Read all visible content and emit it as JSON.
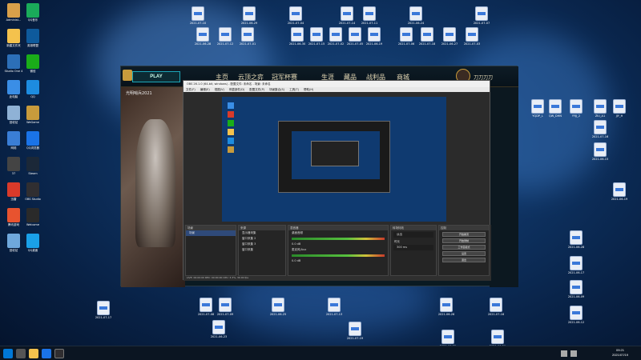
{
  "desktop": {
    "left_icons": [
      {
        "label": "Administ...",
        "color": "#d9a04a"
      },
      {
        "label": "新建文件夹",
        "color": "#f4c24d"
      },
      {
        "label": "Studio One 4",
        "color": "#2c6fb8"
      },
      {
        "label": "此电脑",
        "color": "#3a8ee6"
      },
      {
        "label": "回收站",
        "color": "#8fb2d6"
      },
      {
        "label": "网络",
        "color": "#3a7ed6"
      },
      {
        "label": "37",
        "color": "#444"
      },
      {
        "label": "迅雷",
        "color": "#d93a2a"
      },
      {
        "label": "腾讯游戏",
        "color": "#e8532f"
      },
      {
        "label": "回收站",
        "color": "#6fa8dc"
      },
      {
        "label": "QQ音乐",
        "color": "#1aab5a"
      },
      {
        "label": "英雄联盟",
        "color": "#0e5a9c"
      },
      {
        "label": "微信",
        "color": "#1aad19"
      },
      {
        "label": "QQ",
        "color": "#1d8ce0"
      },
      {
        "label": "WeGame",
        "color": "#c89b3c"
      },
      {
        "label": "QQ浏览器",
        "color": "#1a73e8"
      },
      {
        "label": "Steam",
        "color": "#1b2838"
      },
      {
        "label": "OBS Studio",
        "color": "#302e31"
      },
      {
        "label": "Welcome",
        "color": "#2a2a2a"
      },
      {
        "label": "QQ桌面",
        "color": "#1aa0e8"
      }
    ],
    "doc_labels": [
      "2021-06-28",
      "2021-07-12",
      "2021-07-01",
      "2021-06-30",
      "2021-07-15",
      "2021-07-02",
      "2021-07-05",
      "2021-06-19",
      "2021-07-06",
      "2021-07-18",
      "2021-06-27",
      "2021-07-03",
      "2021-07-10",
      "2021-06-29",
      "2021-07-04",
      "2021-07-14",
      "2021-07-11",
      "2021-06-24",
      "2021-07-07",
      "2021-07-08",
      "2021-07-09",
      "2021-06-25",
      "2021-07-13",
      "2021-06-26",
      "2021-07-16",
      "2021-07-17",
      "2021-06-22",
      "2021-06-21",
      "2021-06-23",
      "2021-07-19"
    ],
    "right_labels": [
      "YQDP_L",
      "QW_DHN",
      "YYJJ_2",
      "ZIU_A1",
      "JJY_H",
      "2021-06-28",
      "2021-06-17",
      "2021-06-09",
      "2021-06-12",
      "2021-07-16",
      "2021-06-15",
      "2021-06-19"
    ]
  },
  "lol": {
    "play_label": "PLAY",
    "tabs": [
      {
        "label": "主页",
        "key": "home"
      },
      {
        "label": "云顶之弈",
        "key": "tft"
      },
      {
        "label": "冠军杯赛",
        "key": "clash"
      },
      {
        "label": "生涯",
        "key": "profile"
      },
      {
        "label": "藏品",
        "key": "collection"
      },
      {
        "label": "战利品",
        "key": "loot"
      },
      {
        "label": "商城",
        "key": "store"
      }
    ],
    "profile_name": "刀刀刀刀",
    "side_title": "光明哨兵2021"
  },
  "obs": {
    "title": "OBS 26.1.0 (64-bit, windows) - 配置文件: 未命名 - 场景: 未命名",
    "menu": [
      "文件(F)",
      "编辑(E)",
      "视图(V)",
      "停靠部件(D)",
      "配置文件(P)",
      "场景集合(S)",
      "工具(T)",
      "帮助(H)"
    ],
    "dock": {
      "scenes_header": "场景",
      "scenes": [
        "场景"
      ],
      "sources_header": "来源",
      "sources": [
        "显示器采集",
        "窗口采集 2",
        "窗口采集 3",
        "窗口采集"
      ],
      "mixer_header": "混音器",
      "mixer_tracks": [
        {
          "name": "桌面音频",
          "db": "0.0 dB"
        },
        {
          "name": "麦克风/Aux",
          "db": "0.0 dB"
        }
      ],
      "transitions_header": "转场特效",
      "transition_type": "淡出",
      "duration_label": "时长",
      "duration_value": "300 ms",
      "controls_header": "控制",
      "controls": [
        "开始推流",
        "开始录制",
        "工作室模式",
        "设置",
        "退出"
      ]
    },
    "status": "LIVE: 00:00:00  REC: 00:00:00  CPU: 3.3%, 30.00 fps"
  },
  "taskbar": {
    "time": "09:21",
    "date": "2021/07/19"
  }
}
